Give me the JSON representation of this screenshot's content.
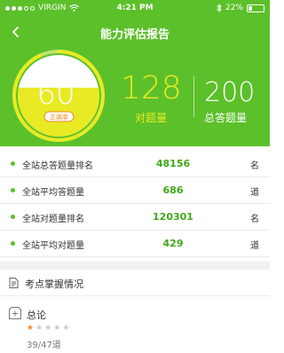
{
  "status_bar": {
    "carrier": "VIRGIN",
    "time": "4:21 PM",
    "battery": "22%",
    "battery_level": 0.22,
    "signal_bars": 5,
    "signal_filled": 3
  },
  "nav": {
    "title": "能力评估报告",
    "back_icon": "chevron-left-icon"
  },
  "gauge": {
    "value": "60",
    "unit": "%",
    "caption": "正确率",
    "fill_fraction": 0.6,
    "ring_fraction": 0.93
  },
  "scores": {
    "correct_value": "128",
    "correct_label": "对题量",
    "total_value": "200",
    "total_label": "总答题量"
  },
  "stats": [
    {
      "label": "全站总答题量排名",
      "value": "48156",
      "unit": "名"
    },
    {
      "label": "全站平均答题量",
      "value": "686",
      "unit": "道"
    },
    {
      "label": "全站对题量排名",
      "value": "120301",
      "unit": "名"
    },
    {
      "label": "全站平均对题量",
      "value": "429",
      "unit": "道"
    }
  ],
  "section": {
    "title": "考点掌握情况",
    "icon": "document-icon"
  },
  "topic": {
    "title": "总论",
    "icon": "plus-box-icon",
    "stars_total": 5,
    "stars_filled": 1,
    "progress": "39/47道"
  },
  "colors": {
    "brand_green": "#5cc02a",
    "highlight_yellow": "#e8ea24",
    "star_orange": "#f08c1e"
  }
}
